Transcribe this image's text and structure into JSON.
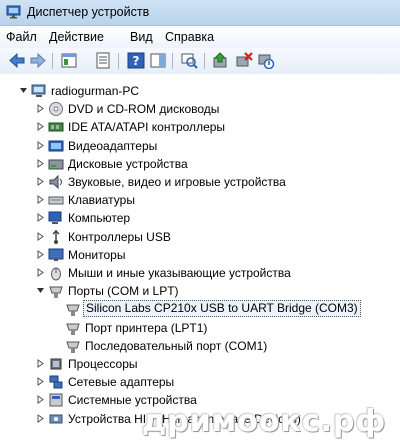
{
  "window": {
    "title": "Диспетчер устройств"
  },
  "menu": {
    "file": "Файл",
    "action": "Действие",
    "view": "Вид",
    "help": "Справка"
  },
  "tree": {
    "root": "radiogurman-PC",
    "categories": [
      "DVD и CD-ROM дисководы",
      "IDE ATA/ATAPI контроллеры",
      "Видеоадаптеры",
      "Дисковые устройства",
      "Звуковые, видео и игровые устройства",
      "Клавиатуры",
      "Компьютер",
      "Контроллеры USB",
      "Мониторы",
      "Мыши и иные указывающие устройства",
      "Порты (COM и LPT)"
    ],
    "ports": [
      "Silicon Labs CP210x USB to UART Bridge (COM3)",
      "Порт принтера (LPT1)",
      "Последовательный порт (COM1)"
    ],
    "after": [
      "Процессоры",
      "Сетевые адаптеры",
      "Системные устройства",
      "Устройства HID (Human Interface Devices)"
    ]
  },
  "watermark": "дримоокс.рф"
}
